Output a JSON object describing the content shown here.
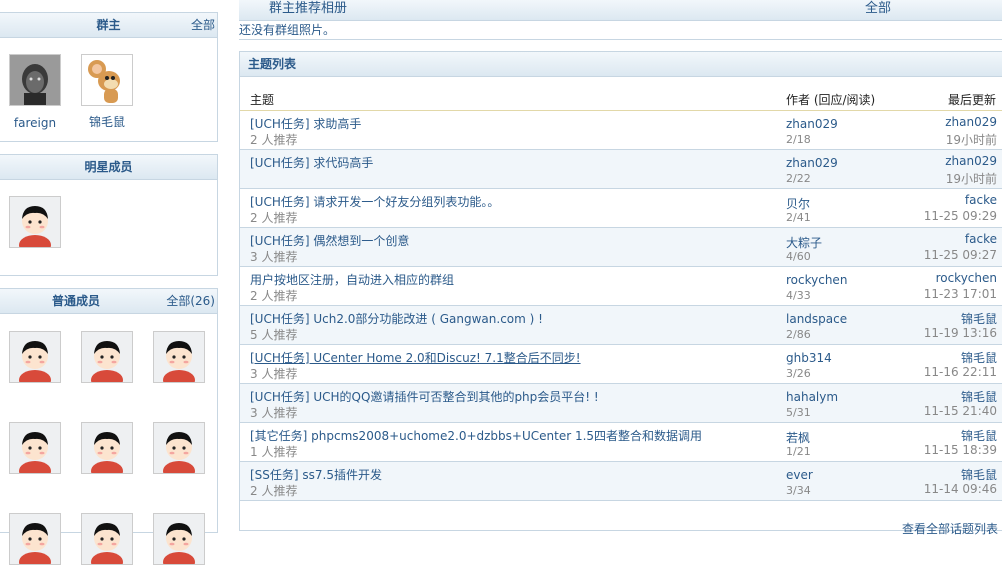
{
  "owners": {
    "title": "群主",
    "more": "全部",
    "members": [
      {
        "name": "fareign",
        "avatar": "photo-avatar"
      },
      {
        "name": "锦毛鼠",
        "avatar": "cartoon-mouse-avatar"
      }
    ]
  },
  "stars": {
    "title": "明星成员"
  },
  "members": {
    "title": "普通成员",
    "more": "全部(26)"
  },
  "album": {
    "title": "群主推荐相册",
    "more": "全部",
    "empty": "还没有群组照片。"
  },
  "topics": {
    "title": "主题列表",
    "col_subject": "主题",
    "col_author": "作者 (回应/阅读)",
    "col_last": "最后更新",
    "bottom_more": "查看全部话题列表",
    "rows": [
      {
        "title": "[UCH任务] 求助高手",
        "rec": "2 人推荐",
        "author": "zhan029",
        "stat": "2/18",
        "last": "zhan029",
        "time": "19小时前"
      },
      {
        "title": "[UCH任务] 求代码高手",
        "rec": "",
        "author": "zhan029",
        "stat": "2/22",
        "last": "zhan029",
        "time": "19小时前"
      },
      {
        "title": "[UCH任务] 请求开发一个好友分组列表功能。。",
        "rec": "2 人推荐",
        "author": "贝尔",
        "stat": "2/41",
        "last": "facke",
        "time": "11-25 09:29"
      },
      {
        "title": "[UCH任务] 偶然想到一个创意",
        "rec": "3 人推荐",
        "author": "大粽子",
        "stat": "4/60",
        "last": "facke",
        "time": "11-25 09:27"
      },
      {
        "title": "用户按地区注册，自动进入相应的群组",
        "rec": "2 人推荐",
        "author": "rockychen",
        "stat": "4/33",
        "last": "rockychen",
        "time": "11-23 17:01"
      },
      {
        "title": "[UCH任务] Uch2.0部分功能改进 ( Gangwan.com ) !",
        "rec": "5 人推荐",
        "author": "landspace",
        "stat": "2/86",
        "last": "锦毛鼠",
        "time": "11-19 13:16"
      },
      {
        "title": "[UCH任务] UCenter Home 2.0和Discuz! 7.1整合后不同步!",
        "rec": "3 人推荐",
        "author": "ghb314",
        "stat": "3/26",
        "last": "锦毛鼠",
        "time": "11-16 22:11"
      },
      {
        "title": "[UCH任务] UCH的QQ邀请插件可否整合到其他的php会员平台! !",
        "rec": "3 人推荐",
        "author": "hahalym",
        "stat": "5/31",
        "last": "锦毛鼠",
        "time": "11-15 21:40"
      },
      {
        "title": "[其它任务] phpcms2008+uchome2.0+dzbbs+UCenter 1.5四者整合和数据调用",
        "rec": "1 人推荐",
        "author": "若枫",
        "stat": "1/21",
        "last": "锦毛鼠",
        "time": "11-15 18:39"
      },
      {
        "title": "[SS任务] ss7.5插件开发",
        "rec": "2 人推荐",
        "author": "ever",
        "stat": "3/34",
        "last": "锦毛鼠",
        "time": "11-14 09:46"
      }
    ]
  }
}
